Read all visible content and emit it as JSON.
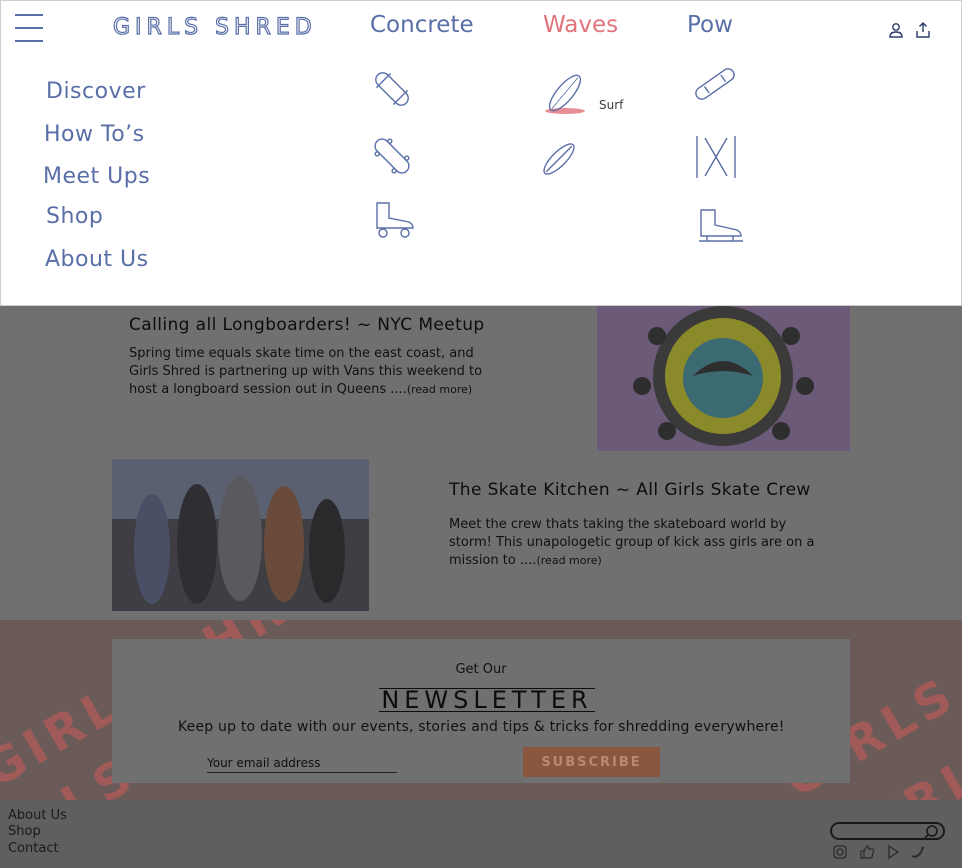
{
  "nav": {
    "logo": "GIRLS SHRED",
    "menu": [
      "Discover",
      "How To’s",
      "Meet Ups",
      "Shop",
      "About Us"
    ],
    "categories": [
      "Concrete",
      "Waves",
      "Pow"
    ],
    "active_category": "Waves",
    "surf_label": "Surf",
    "icons": {
      "concrete": [
        "skateboard-icon",
        "longboard-icon",
        "roller-skate-icon"
      ],
      "waves": [
        "surfboard-icon",
        "bodyboard-icon"
      ],
      "pow": [
        "snowboard-icon",
        "skis-icon",
        "ice-skate-icon"
      ]
    }
  },
  "articles": [
    {
      "title": "Calling all Longboarders! ~ NYC Meetup",
      "excerpt": "Spring time equals skate time on the east coast, and Girls Shred is partnering up with Vans this weekend to host a longboard session out in Queens ....",
      "read_more": "(read more)"
    },
    {
      "title": "The Skate Kitchen ~ All Girls Skate Crew",
      "excerpt": "Meet the crew thats taking the skateboard world by storm! This unapologetic group of kick ass girls are on a mission to ....",
      "read_more": "(read more)"
    }
  ],
  "newsletter": {
    "get_our": "Get Our",
    "title": "NEWSLETTER",
    "subtitle": "Keep up to date with our events, stories and tips & tricks for shredding everywhere!",
    "placeholder": "Your email address",
    "button": "SUBSCRIBE",
    "pattern_text": "GIRLS SHRED"
  },
  "footer": {
    "links": [
      "About Us",
      "Shop",
      "Contact"
    ],
    "social": [
      "instagram-icon",
      "like-icon",
      "play-icon",
      "twitter-icon"
    ]
  },
  "colors": {
    "accent_blue": "#5a6ea8",
    "accent_pink": "#e2737c",
    "overlay": "#707070"
  }
}
